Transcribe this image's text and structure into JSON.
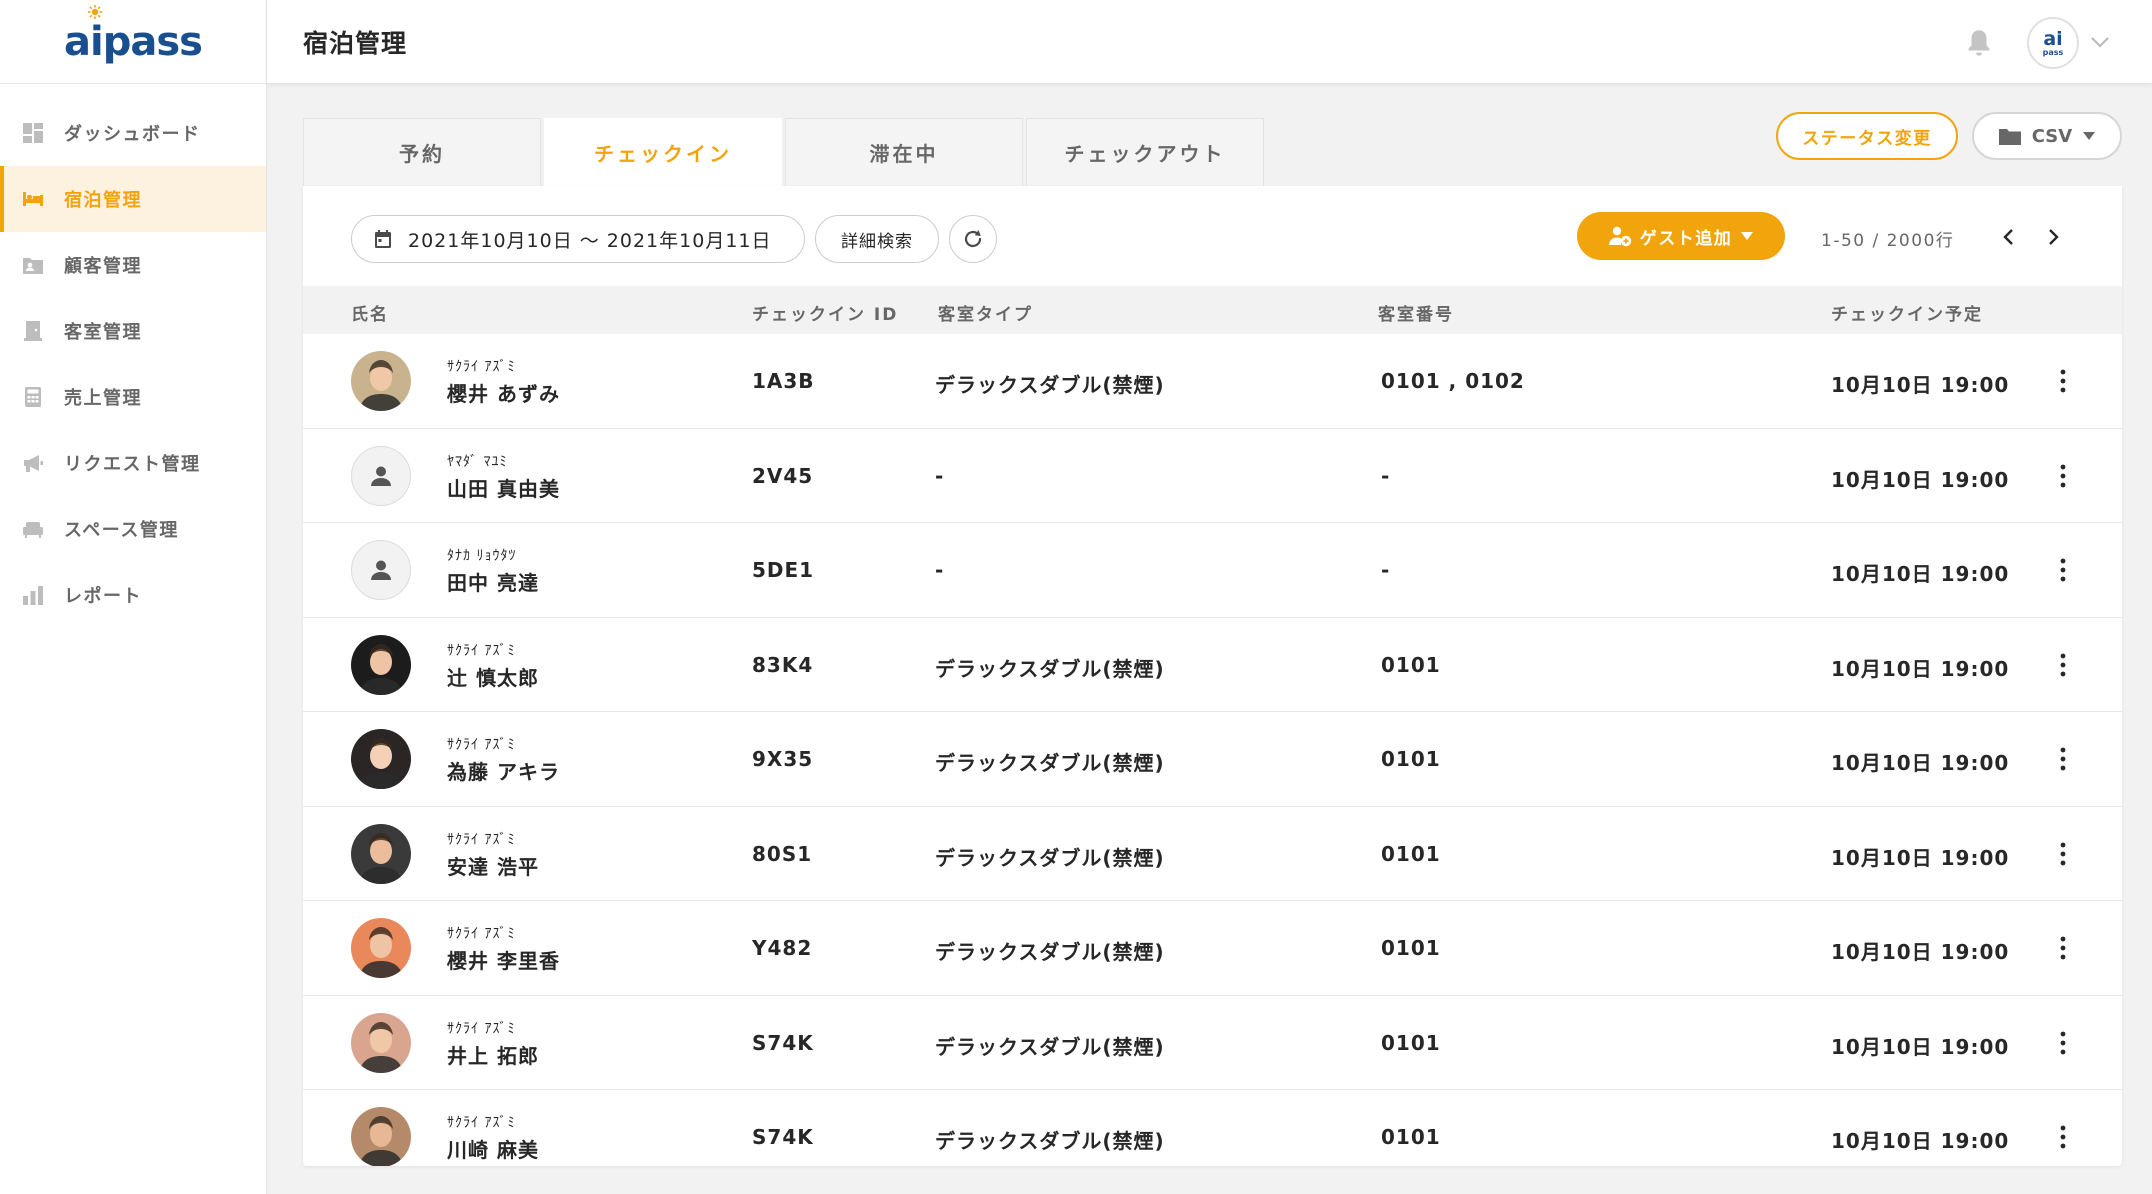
{
  "brand": {
    "logo_text": "aipass",
    "avatar_top": "ai",
    "avatar_bottom": "pass"
  },
  "sidebar": {
    "items": [
      {
        "label": "ダッシュボード",
        "icon": "dashboard-icon"
      },
      {
        "label": "宿泊管理",
        "icon": "bed-icon",
        "active": true
      },
      {
        "label": "顧客管理",
        "icon": "contact-card-icon"
      },
      {
        "label": "客室管理",
        "icon": "room-icon"
      },
      {
        "label": "売上管理",
        "icon": "calculator-icon"
      },
      {
        "label": "リクエスト管理",
        "icon": "megaphone-icon"
      },
      {
        "label": "スペース管理",
        "icon": "sofa-icon"
      },
      {
        "label": "レポート",
        "icon": "bar-chart-icon"
      }
    ]
  },
  "header": {
    "title": "宿泊管理"
  },
  "actions": {
    "status_change": "ステータス変更",
    "csv": "CSV"
  },
  "tabs": [
    {
      "label": "予約"
    },
    {
      "label": "チェックイン",
      "active": true
    },
    {
      "label": "滞在中"
    },
    {
      "label": "チェックアウト"
    }
  ],
  "toolbar": {
    "date_range": "2021年10月10日 ～ 2021年10月11日",
    "detail_search": "詳細検索",
    "add_guest": "ゲスト追加",
    "pagination": "1-50 / 2000行"
  },
  "table": {
    "columns": [
      "氏名",
      "チェックイン ID",
      "客室タイプ",
      "客室番号",
      "チェックイン予定"
    ],
    "rows": [
      {
        "kana": "ｻｸﾗｲ ｱｽﾞﾐ",
        "name": "櫻井 あずみ",
        "id": "1A3B",
        "room_type": "デラックスダブル(禁煙)",
        "room_no": "0101 , 0102",
        "checkin": "10月10日 19:00",
        "avatar": "photo",
        "color": "#c9b38f"
      },
      {
        "kana": "ﾔﾏﾀﾞ ﾏﾕﾐ",
        "name": "山田 真由美",
        "id": "2V45",
        "room_type": "-",
        "room_no": "-",
        "checkin": "10月10日 19:00",
        "avatar": "placeholder",
        "color": "#f2f2f2"
      },
      {
        "kana": "ﾀﾅｶ ﾘｮｳﾀﾂ",
        "name": "田中 亮達",
        "id": "5DE1",
        "room_type": "-",
        "room_no": "-",
        "checkin": "10月10日 19:00",
        "avatar": "placeholder",
        "color": "#f2f2f2"
      },
      {
        "kana": "ｻｸﾗｲ ｱｽﾞﾐ",
        "name": "辻 慎太郎",
        "id": "83K4",
        "room_type": "デラックスダブル(禁煙)",
        "room_no": "0101",
        "checkin": "10月10日 19:00",
        "avatar": "photo",
        "color": "#1c1c1c"
      },
      {
        "kana": "ｻｸﾗｲ ｱｽﾞﾐ",
        "name": "為藤 アキラ",
        "id": "9X35",
        "room_type": "デラックスダブル(禁煙)",
        "room_no": "0101",
        "checkin": "10月10日 19:00",
        "avatar": "photo",
        "color": "#2a2626"
      },
      {
        "kana": "ｻｸﾗｲ ｱｽﾞﾐ",
        "name": "安達 浩平",
        "id": "80S1",
        "room_type": "デラックスダブル(禁煙)",
        "room_no": "0101",
        "checkin": "10月10日 19:00",
        "avatar": "photo",
        "color": "#3a3a3a"
      },
      {
        "kana": "ｻｸﾗｲ ｱｽﾞﾐ",
        "name": "櫻井 李里香",
        "id": "Y482",
        "room_type": "デラックスダブル(禁煙)",
        "room_no": "0101",
        "checkin": "10月10日 19:00",
        "avatar": "photo",
        "color": "#e9885a"
      },
      {
        "kana": "ｻｸﾗｲ ｱｽﾞﾐ",
        "name": "井上 拓郎",
        "id": "S74K",
        "room_type": "デラックスダブル(禁煙)",
        "room_no": "0101",
        "checkin": "10月10日 19:00",
        "avatar": "photo",
        "color": "#d9a58f"
      },
      {
        "kana": "ｻｸﾗｲ ｱｽﾞﾐ",
        "name": "川崎 麻美",
        "id": "S74K",
        "room_type": "デラックスダブル(禁煙)",
        "room_no": "0101",
        "checkin": "10月10日 19:00",
        "avatar": "photo",
        "color": "#b48a6a"
      }
    ]
  },
  "colors": {
    "accent": "#f2a40c",
    "brand": "#1a4f8f",
    "text": "#272727",
    "muted": "#676767",
    "background": "#f2f2f2"
  }
}
